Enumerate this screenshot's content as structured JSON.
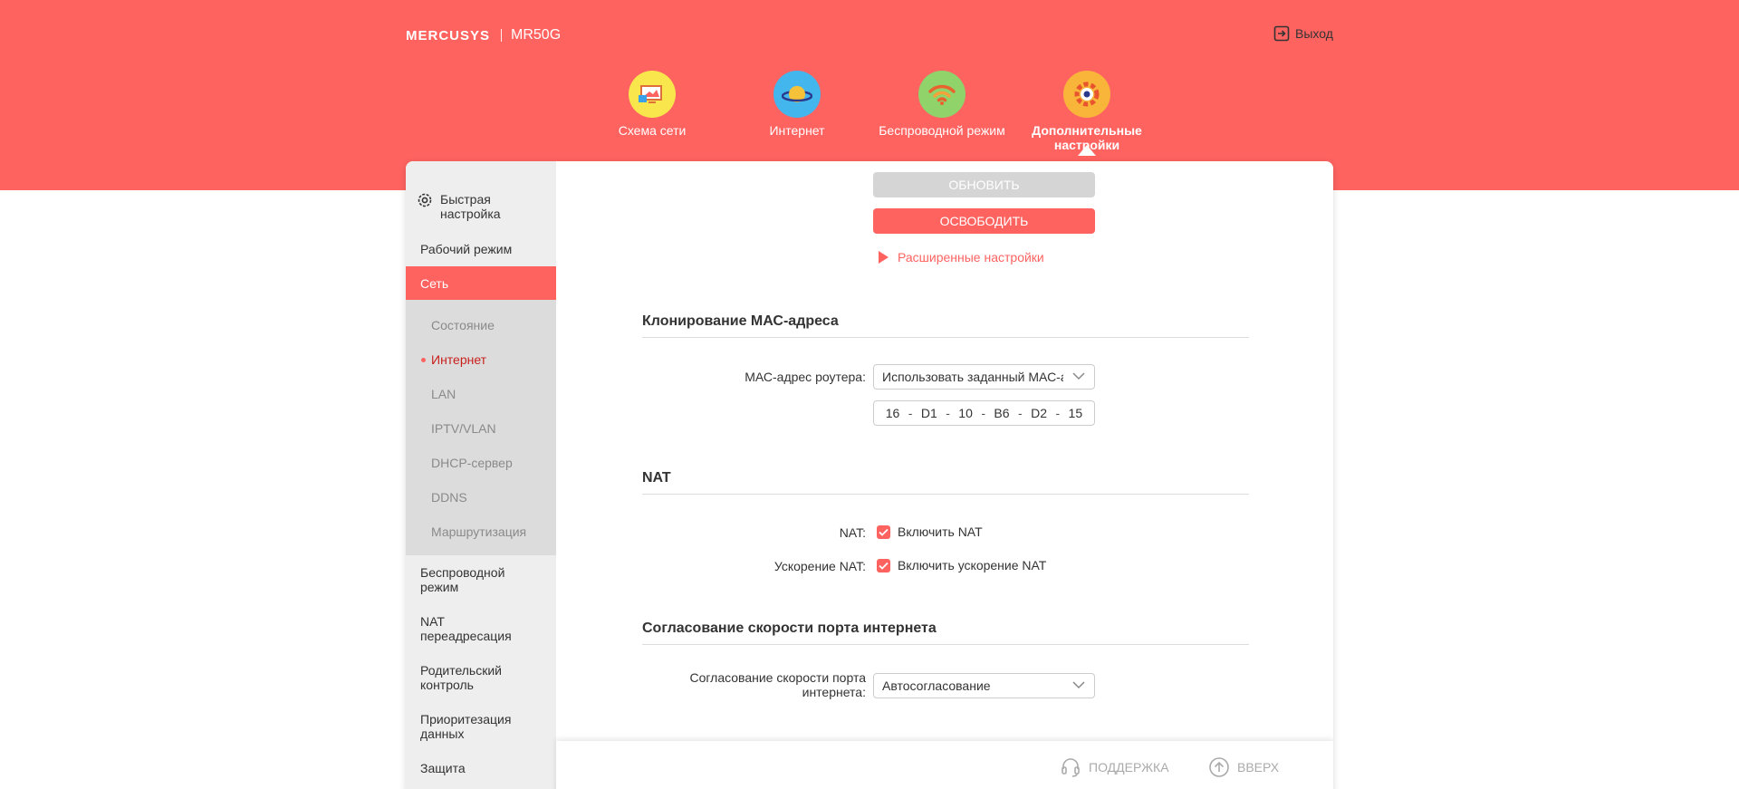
{
  "header": {
    "brand": "MERCUSYS",
    "model": "MR50G",
    "logout_label": "Выход"
  },
  "nav_tabs": [
    {
      "label": "Схема сети",
      "icon": "network-map-icon"
    },
    {
      "label": "Интернет",
      "icon": "planet-icon"
    },
    {
      "label": "Беспроводной режим",
      "icon": "wifi-icon"
    },
    {
      "label": "Дополнительные настройки",
      "icon": "gear-icon",
      "active": true
    }
  ],
  "sidebar": {
    "quick_setup": "Быстрая настройка",
    "operation_mode": "Рабочий режим",
    "network": "Сеть",
    "network_sub": [
      "Состояние",
      "Интернет",
      "LAN",
      "IPTV/VLAN",
      "DHCP-сервер",
      "DDNS",
      "Маршрутизация"
    ],
    "active_sub": "Интернет",
    "items_after": [
      "Беспроводной режим",
      "NAT переадресация",
      "Родительский контроль",
      "Приоритезация данных",
      "Защита"
    ]
  },
  "content": {
    "renew_label": "ОБНОВИТЬ",
    "release_label": "ОСВОБОДИТЬ",
    "advanced_label": "Расширенные настройки",
    "mac_section": {
      "title": "Клонирование МАС-адреса",
      "router_mac_label": "МАС-адрес роутера:",
      "router_mac_value": "Использовать заданный МАС-адрес",
      "mac_octets": [
        "16",
        "D1",
        "10",
        "B6",
        "D2",
        "15"
      ]
    },
    "nat_section": {
      "title": "NAT",
      "nat_label": "NAT:",
      "nat_checkbox": "Включить NAT",
      "nat_checked": true,
      "accel_label": "Ускорение NAT:",
      "accel_checkbox": "Включить ускорение NAT",
      "accel_checked": true
    },
    "speed_section": {
      "title": "Согласование скорости порта интернета",
      "label": "Согласование скорости порта интернета:",
      "value": "Автосогласование"
    }
  },
  "footer": {
    "support_label": "ПОДДЕРЖКА",
    "top_label": "ВВЕРХ"
  },
  "colors": {
    "accent": "#fe6360",
    "sidebar_bg": "#eeeeee",
    "subnav_bg": "#dcdcdc"
  }
}
